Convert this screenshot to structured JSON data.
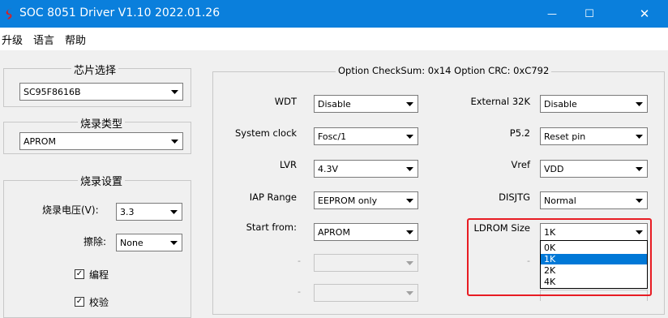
{
  "window": {
    "title": "SOC 8051 Driver V1.10 2022.01.26",
    "minimize": "—",
    "maximize": "☐",
    "close": "✕"
  },
  "menu": [
    "升级",
    "语言",
    "帮助"
  ],
  "left": {
    "chip": {
      "legend": "芯片选择",
      "value": "SC95F8616B"
    },
    "burn_type": {
      "legend": "烧录类型",
      "value": "APROM"
    },
    "burn_settings": {
      "legend": "烧录设置",
      "voltage_label": "烧录电压(V):",
      "voltage_value": "3.3",
      "erase_label": "擦除:",
      "erase_value": "None",
      "program_label": "编程",
      "verify_label": "校验"
    }
  },
  "option": {
    "legend": "Option CheckSum: 0x14 Option CRC: 0xC792",
    "fields_left": [
      {
        "label": "WDT",
        "value": "Disable"
      },
      {
        "label": "System clock",
        "value": "Fosc/1"
      },
      {
        "label": "LVR",
        "value": "4.3V"
      },
      {
        "label": "IAP Range",
        "value": "EEPROM only"
      },
      {
        "label": "Start from:",
        "value": "APROM"
      },
      {
        "label": "-",
        "value": ""
      },
      {
        "label": "-",
        "value": ""
      }
    ],
    "fields_right": [
      {
        "label": "External 32K",
        "value": "Disable"
      },
      {
        "label": "P5.2",
        "value": "Reset pin"
      },
      {
        "label": "Vref",
        "value": "VDD"
      },
      {
        "label": "DISJTG",
        "value": "Normal"
      },
      {
        "label": "LDROM Size",
        "value": "1K"
      },
      {
        "label": "-",
        "value": ""
      }
    ],
    "ldrom_options": [
      "0K",
      "1K",
      "2K",
      "4K"
    ],
    "ldrom_selected": "1K"
  },
  "colors": {
    "titlebar": "#0a7fdc",
    "highlight": "#0078d7",
    "annotation": "#e81c23"
  }
}
